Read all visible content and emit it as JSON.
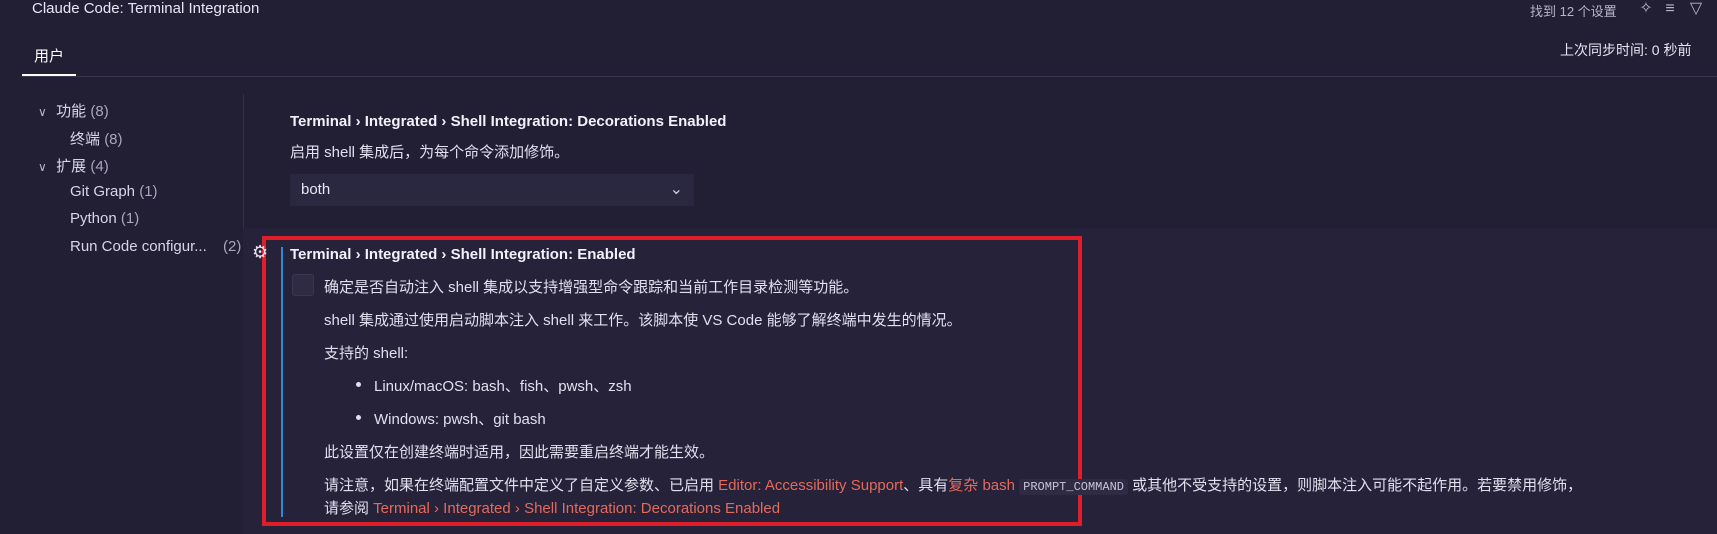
{
  "search": {
    "query": "Claude Code: Terminal Integration",
    "count": "找到 12 个设置"
  },
  "header": {
    "tab_user": "用户",
    "sync_status": "上次同步时间: 0 秒前"
  },
  "toc": [
    {
      "label": "功能",
      "count": "(8)"
    },
    {
      "label": "终端",
      "count": "(8)"
    },
    {
      "label": "扩展",
      "count": "(4)"
    },
    {
      "label": "Git Graph",
      "count": "(1)"
    },
    {
      "label": "Python",
      "count": "(1)"
    },
    {
      "label": "Run Code configur...",
      "count": "(2)"
    }
  ],
  "setting_decorations": {
    "title": "Terminal › Integrated › Shell Integration: Decorations Enabled",
    "description": "启用 shell 集成后，为每个命令添加修饰。",
    "value": "both"
  },
  "setting_enabled": {
    "title": "Terminal › Integrated › Shell Integration: Enabled",
    "desc1": "确定是否自动注入 shell 集成以支持增强型命令跟踪和当前工作目录检测等功能。",
    "desc2": "shell 集成通过使用启动脚本注入 shell 来工作。该脚本使 VS Code 能够了解终端中发生的情况。",
    "desc3": "支持的 shell:",
    "bullet1": "Linux/macOS: bash、fish、pwsh、zsh",
    "bullet2": "Windows: pwsh、git bash",
    "desc4": "此设置仅在创建终端时适用，因此需要重启终端才能生效。",
    "note_prefix": "请注意，如果在终端配置文件中定义了自定义参数、已启用 ",
    "note_link1": "Editor: Accessibility Support",
    "note_mid": "、具有",
    "note_link2": "复杂 bash",
    "note_code": "PROMPT_COMMAND",
    "note_suffix": " 或其他不受支持的设置，则脚本注入可能不起作用。若要禁用修饰，",
    "note_line2_prefix": "请参阅 ",
    "note_link3": "Terminal › Integrated › Shell Integration: Decorations Enabled"
  },
  "colors": {
    "highlight": "#e01e2a",
    "link": "#e46a5c",
    "focus_bar": "#2e8bd4"
  }
}
